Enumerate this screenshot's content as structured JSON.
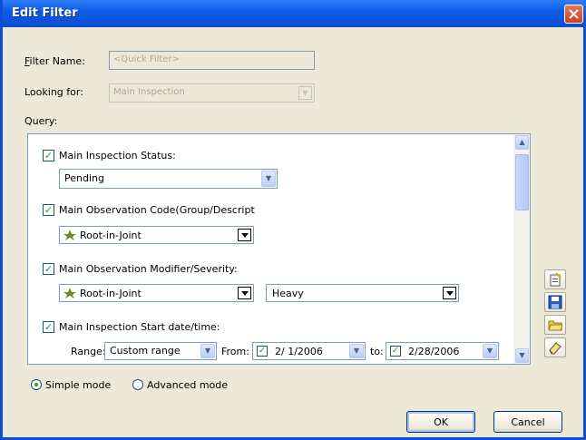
{
  "window": {
    "title": "Edit Filter"
  },
  "filter_name": {
    "label_first": "F",
    "label_rest": "ilter Name:",
    "placeholder": "<Quick Filter>"
  },
  "looking_for": {
    "label": "Looking for:",
    "value": "Main Inspection"
  },
  "query": {
    "label": "Query:"
  },
  "conditions": {
    "status": {
      "label": "Main Inspection Status:",
      "checked": true,
      "value": "Pending"
    },
    "code": {
      "label": "Main Observation Code(Group/Descript",
      "checked": true,
      "value": "Root-in-Joint"
    },
    "modifier": {
      "label": "Main Observation Modifier/Severity:",
      "checked": true,
      "value": "Root-in-Joint",
      "severity": "Heavy"
    },
    "start_date": {
      "label": "Main Inspection Start date/time:",
      "checked": true,
      "range_label": "Range:",
      "range_value": "Custom range",
      "from_label": "From:",
      "from_value": "2/ 1/2006",
      "to_label": "to:",
      "to_value": "2/28/2006"
    }
  },
  "side_toolbar": {
    "icons": [
      "new-filter-icon",
      "save-icon",
      "open-folder-icon",
      "eraser-icon"
    ]
  },
  "mode": {
    "simple_label": "Simple mode",
    "advanced_label": "Advanced mode",
    "selected": "simple"
  },
  "buttons": {
    "ok": "OK",
    "cancel": "Cancel"
  },
  "colors": {
    "titlebar": "#0d5ce6",
    "window_bg": "#ece9d8",
    "check_mark": "#21a121"
  }
}
